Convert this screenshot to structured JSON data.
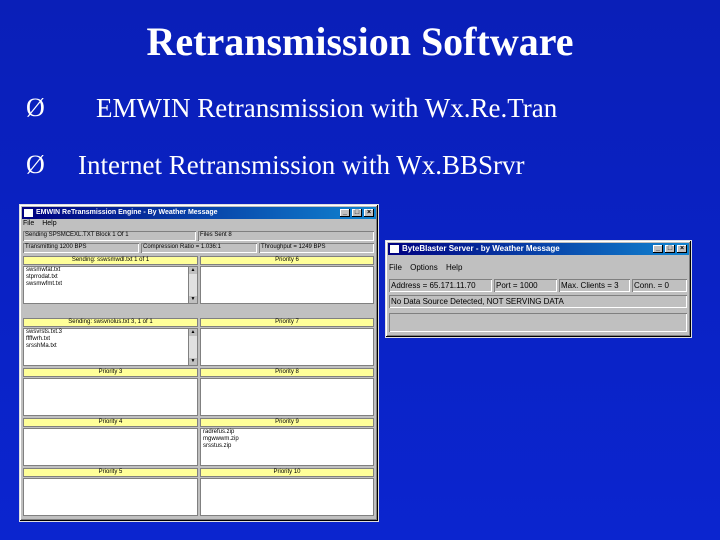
{
  "slide": {
    "title": "Retransmission Software",
    "bullet_mark": "Ø",
    "bullets": [
      "EMWIN Retransmission with Wx.Re.Tran",
      "Internet Retransmission with Wx.BBSrvr"
    ]
  },
  "retran_window": {
    "title": "EMWIN ReTransmission Engine - By Weather Message",
    "menu": [
      "File",
      "Help"
    ],
    "min": "_",
    "max": "□",
    "close": "×",
    "status_row1": {
      "sending": "Sending   SPSMCEXL.TXT  Block   1  Of  1",
      "files_sent": "Files Sent     8"
    },
    "status_row2": {
      "transmitting": "Transmitting 1200 BPS",
      "compression": "Compression Ratio = 1.036:1",
      "throughput": "Throughput = 1249 BPS"
    },
    "priorities": [
      {
        "label": "Sending: sswsmwdl.txt 1 of 1",
        "items": [
          "swsmwfat.txt",
          "stprrodat.txt",
          "swsmwfmt.txt"
        ],
        "scroll": true
      },
      {
        "label": "Priority 6",
        "items": []
      },
      {
        "label": "Sending: swsvnolus.txt 3, 1 of 1",
        "items": [
          "swsvrsts.txt.3",
          "ffffwrh.txt",
          "srsshMa.txt"
        ],
        "scroll": true
      },
      {
        "label": "Priority 7",
        "items": []
      },
      {
        "label": "Priority 3",
        "items": []
      },
      {
        "label": "Priority 8",
        "items": []
      },
      {
        "label": "Priority 4",
        "items": []
      },
      {
        "label": "Priority 9",
        "items": [
          "radrefus.zip",
          "mgwwwm.zip",
          "srsstus.zip"
        ]
      },
      {
        "label": "Priority 5",
        "items": []
      },
      {
        "label": "Priority 10",
        "items": []
      }
    ]
  },
  "bbs_window": {
    "title": "ByteBlaster Server - by Weather Message",
    "menu": [
      "File",
      "Options",
      "Help"
    ],
    "min": "_",
    "max": "□",
    "close": "×",
    "address": "Address = 65.171.11.70",
    "port": "Port = 1000",
    "max_clients": "Max. Clients = 3",
    "conn": "Conn. = 0",
    "status": "No Data Source Detected, NOT SERVING DATA"
  }
}
